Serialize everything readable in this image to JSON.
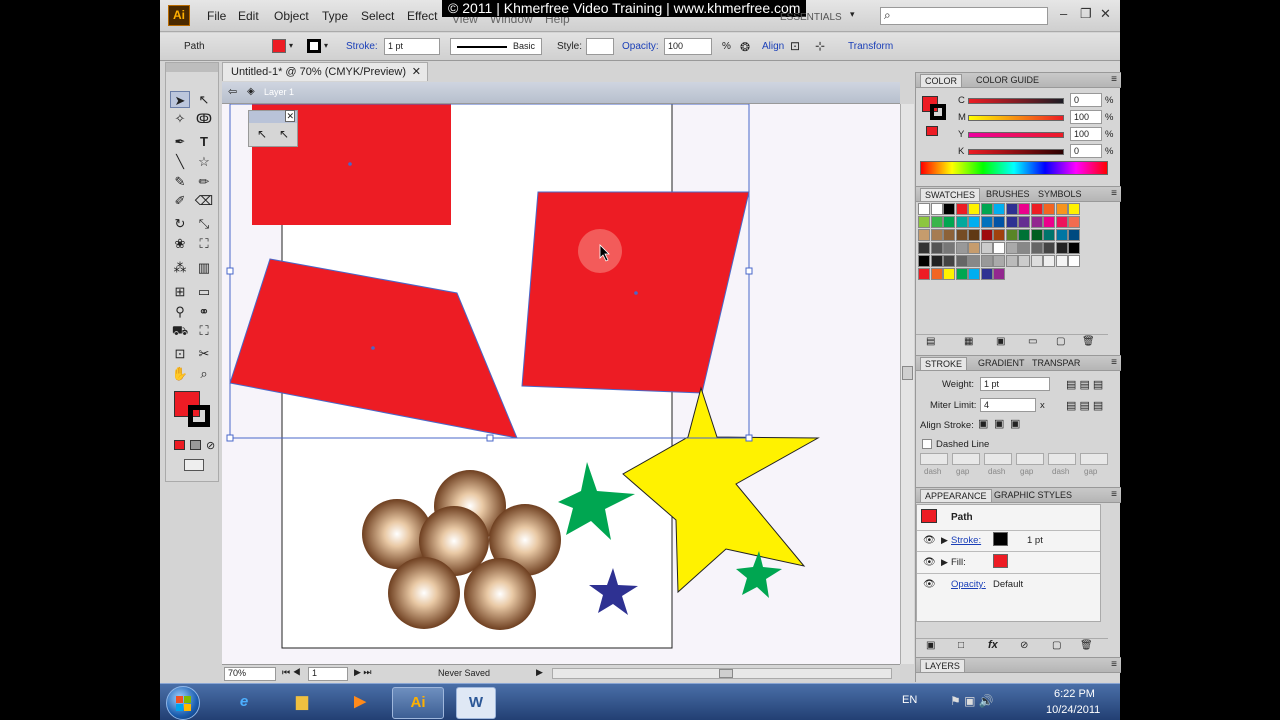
{
  "app": {
    "logo": "Ai"
  },
  "menu": [
    "File",
    "Edit",
    "Object",
    "Type",
    "Select",
    "Effect",
    "View",
    "Window",
    "Help"
  ],
  "watermark": "© 2011 | Khmerfree Video Training | www.khmerfree.com",
  "workspace": "ESSENTIALS",
  "control_bar": {
    "object_type": "Path",
    "stroke_label": "Stroke:",
    "stroke_weight": "1 pt",
    "brush": "Basic",
    "style_label": "Style:",
    "opacity_label": "Opacity:",
    "opacity_value": "100",
    "opacity_unit": "%",
    "align_label": "Align",
    "transform_label": "Transform",
    "fill_color": "#ed1c24",
    "stroke_color": "#000000"
  },
  "document": {
    "tab_title": "Untitled-1* @ 70% (CMYK/Preview)",
    "layer_name": "Layer 1",
    "zoom": "70%",
    "artboard": "1",
    "save_status": "Never Saved"
  },
  "color_panel": {
    "tabs": [
      "COLOR",
      "COLOR GUIDE"
    ],
    "channels": [
      {
        "label": "C",
        "value": "0",
        "unit": "%"
      },
      {
        "label": "M",
        "value": "100",
        "unit": "%"
      },
      {
        "label": "Y",
        "value": "100",
        "unit": "%"
      },
      {
        "label": "K",
        "value": "0",
        "unit": "%"
      }
    ]
  },
  "swatches_panel": {
    "tabs": [
      "SWATCHES",
      "BRUSHES",
      "SYMBOLS"
    ]
  },
  "stroke_panel": {
    "tabs": [
      "STROKE",
      "GRADIENT",
      "TRANSPAR"
    ],
    "weight_label": "Weight:",
    "weight_value": "1 pt",
    "miter_label": "Miter Limit:",
    "miter_value": "4",
    "miter_unit": "x",
    "align_label": "Align Stroke:",
    "dashed_label": "Dashed Line",
    "dash_labels": [
      "dash",
      "gap",
      "dash",
      "gap",
      "dash",
      "gap"
    ]
  },
  "appearance_panel": {
    "tabs": [
      "APPEARANCE",
      "GRAPHIC STYLES"
    ],
    "object": "Path",
    "stroke_label": "Stroke:",
    "stroke_value": "1 pt",
    "fill_label": "Fill:",
    "opacity_label": "Opacity:",
    "opacity_value": "Default"
  },
  "layers_panel": {
    "tab": "LAYERS"
  },
  "taskbar": {
    "time": "6:22 PM",
    "date": "10/24/2011",
    "lang": "EN",
    "ai_label": "Ai",
    "word_label": "W"
  },
  "colors": {
    "red": "#ed1c24",
    "yellow": "#fff200",
    "green": "#00a651",
    "navy": "#2e3192",
    "brown": "#7a4a2a"
  }
}
